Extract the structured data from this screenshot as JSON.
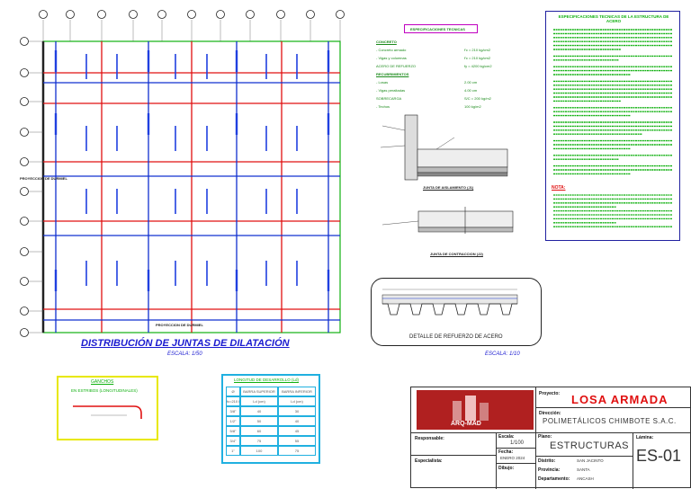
{
  "drawing": {
    "plan_title": "DISTRIBUCIÓN DE JUNTAS DE DILATACIÓN",
    "plan_scale": "ESCALA:  1/50",
    "proyeccion_top": "PROYECCION DE DURMIEL",
    "proyeccion_bottom": "PROYECCION DE DURMIEL",
    "col_axes": [
      "1",
      "2",
      "3",
      "4",
      "5",
      "6",
      "7",
      "8",
      "9",
      "10",
      "11"
    ],
    "row_axes": [
      "A",
      "B",
      "C",
      "D",
      "E",
      "F",
      "G",
      "H",
      "I",
      "J",
      "K"
    ],
    "colors": {
      "grid_red": "#e01010",
      "grid_blue": "#1030d0",
      "dash_blue": "#2040e0",
      "green": "#10b010",
      "title_blue": "#1a1ad0",
      "yellow": "#e8e800",
      "magenta": "#c000c0",
      "dark_red": "#b02020"
    }
  },
  "specs": {
    "title": "ESPECIFICACIONES TECNICAS",
    "rows": [
      {
        "label": "CONCRETO",
        "value": ""
      },
      {
        "label": "- Concreto armado",
        "value": "f'c = 210 kg/cm2"
      },
      {
        "label": "- Vigas y columnas",
        "value": "f'c = 210 kg/cm2"
      },
      {
        "label": "ACERO DE REFUERZO",
        "value": "fy = 4200 kg/cm2"
      },
      {
        "label": "RECUBRIMIENTOS",
        "value": ""
      },
      {
        "label": "- Losas",
        "value": "2.00 cm"
      },
      {
        "label": "- Vigas peraltadas",
        "value": "4.00 cm"
      },
      {
        "label": "SOBRECARGA",
        "value": "S/C = 200 kg/m2"
      },
      {
        "label": "- Techos",
        "value": "100 kg/m2"
      }
    ]
  },
  "notes_box": {
    "title": "ESPECIFICACIONES TECNICAS DE LA ESTRUCTURA DE ACERO",
    "nota_label": "NOTA:"
  },
  "joints": {
    "insulation_label": "JUNTA DE AISLAMIENTO (J1)",
    "contraction_label": "JUNTA DE CONTRACCION (J2)"
  },
  "detail": {
    "caption": "DETALLE DE REFUERZO DE ACERO",
    "scale": "ESCALA:  1/10"
  },
  "hook": {
    "title": "GANCHOS",
    "subtitle": "EN ESTRIBOS (LONGITUDINALES)"
  },
  "table": {
    "title": "LONGITUD DE DESARROLLO (Ld)",
    "headers": [
      "Ø",
      "BARRA SUPERIOR",
      "BARRA INFERIOR"
    ],
    "subheaders": [
      "fc=210 kg/cm2",
      "Ld (cm)",
      "Ld (cm)"
    ],
    "rows": [
      [
        "3/8\"",
        "40",
        "30"
      ],
      [
        "1/2\"",
        "50",
        "40"
      ],
      [
        "5/8\"",
        "60",
        "45"
      ],
      [
        "3/4\"",
        "75",
        "55"
      ],
      [
        "1\"",
        "100",
        "75"
      ]
    ]
  },
  "titleblock": {
    "logo_text": "ARQ-MAD",
    "proyecto_label": "Proyecto:",
    "proyecto": "LOSA ARMADA",
    "direccion_label": "Dirección:",
    "cliente": "POLIMETÁLICOS CHIMBOTE S.A.C.",
    "responsable_label": "Responsable:",
    "especialista_label": "Especialista:",
    "escala_label": "Escala:",
    "escala": "1/100",
    "fecha_label": "Fecha:",
    "fecha": "ENERO 2024",
    "dibujo_label": "Dibujo:",
    "plano_label": "Plano:",
    "plano": "ESTRUCTURAS",
    "distrito_label": "Distrito:",
    "distrito": "SAN JACINTO",
    "provincia_label": "Provincia:",
    "provincia": "SANTA",
    "departamento_label": "Departamento:",
    "departamento": "ANCASH",
    "lamina_label": "Lámina:",
    "lamina": "ES-01"
  }
}
